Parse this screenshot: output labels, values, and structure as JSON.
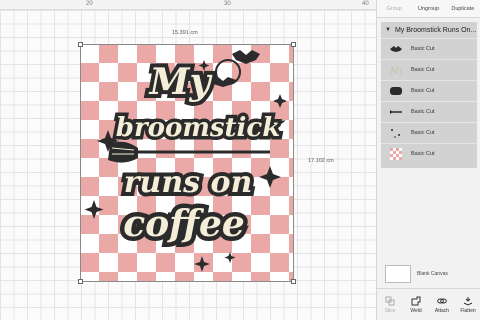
{
  "ruler": {
    "marks": [
      "20",
      "30",
      "40"
    ]
  },
  "dimensions": {
    "width": "15.391 cm",
    "height": "17.102 cm"
  },
  "design": {
    "text_line1": "My",
    "text_line2": "broomstick",
    "text_line3": "runs on",
    "text_line4": "coffee",
    "colors": {
      "pink": "#eaa9a6",
      "cream": "#f4edd8",
      "dark": "#2b2b2b"
    }
  },
  "panel": {
    "tabs": [
      "Group",
      "Ungroup",
      "Duplicate"
    ],
    "group_name": "My Broomstick Runs On...",
    "layers": [
      {
        "label": "Basic Cut",
        "icon": "bat-thumb-icon"
      },
      {
        "label": "Basic Cut",
        "icon": "sparkles-thumb-icon"
      },
      {
        "label": "Basic Cut",
        "icon": "text-shadow-thumb-icon"
      },
      {
        "label": "Basic Cut",
        "icon": "broom-thumb-icon"
      },
      {
        "label": "Basic Cut",
        "icon": "stars-thumb-icon"
      },
      {
        "label": "Basic Cut",
        "icon": "checker-thumb-icon"
      }
    ],
    "blank_canvas_label": "Blank Canvas",
    "tools": [
      {
        "label": "Slice",
        "icon": "slice-icon"
      },
      {
        "label": "Weld",
        "icon": "weld-icon"
      },
      {
        "label": "Attach",
        "icon": "attach-icon"
      },
      {
        "label": "Flatten",
        "icon": "flatten-icon"
      }
    ]
  }
}
